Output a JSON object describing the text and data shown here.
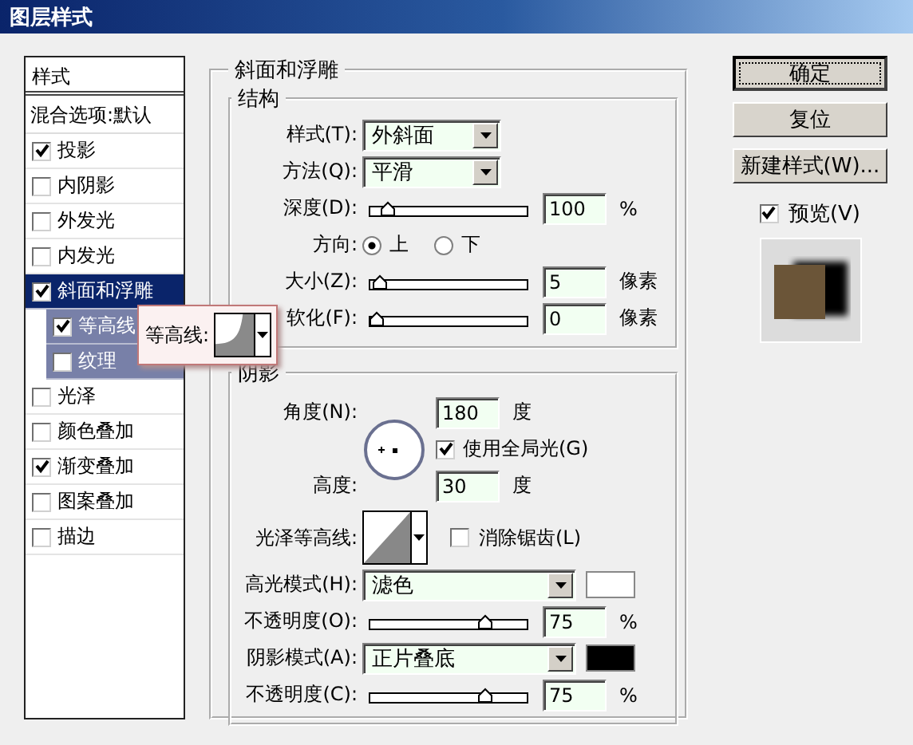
{
  "window": {
    "title": "图层样式"
  },
  "sidebar": {
    "header": "样式",
    "blend_options": "混合选项:默认",
    "items": [
      {
        "label": "投影",
        "checked": true,
        "selected": false
      },
      {
        "label": "内阴影",
        "checked": false,
        "selected": false
      },
      {
        "label": "外发光",
        "checked": false,
        "selected": false
      },
      {
        "label": "内发光",
        "checked": false,
        "selected": false
      },
      {
        "label": "斜面和浮雕",
        "checked": true,
        "selected": true,
        "children": [
          {
            "label": "等高线",
            "checked": true,
            "selected": false
          },
          {
            "label": "纹理",
            "checked": false,
            "selected": false
          }
        ]
      },
      {
        "label": "光泽",
        "checked": false,
        "selected": false
      },
      {
        "label": "颜色叠加",
        "checked": false,
        "selected": false
      },
      {
        "label": "渐变叠加",
        "checked": true,
        "selected": false
      },
      {
        "label": "图案叠加",
        "checked": false,
        "selected": false
      },
      {
        "label": "描边",
        "checked": false,
        "selected": false
      }
    ]
  },
  "contour_popup": {
    "label": "等高线:"
  },
  "bevel": {
    "title": "斜面和浮雕",
    "structure": {
      "title": "结构",
      "rows": [
        {
          "kind": "select",
          "label": "样式(T):",
          "value": "外斜面"
        },
        {
          "kind": "select",
          "label": "方法(Q):",
          "value": "平滑"
        },
        {
          "kind": "slider",
          "label": "深度(D):",
          "level": 0.08,
          "value": "100",
          "unit": "%"
        },
        {
          "kind": "radio",
          "label": "方向:",
          "options": [
            {
              "label": "上",
              "selected": true
            },
            {
              "label": "下",
              "selected": false
            }
          ]
        },
        {
          "kind": "slider",
          "label": "大小(Z):",
          "level": 0.02,
          "value": "5",
          "unit": "像素"
        },
        {
          "kind": "slider",
          "label": "软化(F):",
          "level": 0,
          "value": "0",
          "unit": "像素"
        }
      ]
    },
    "shading": {
      "title": "阴影",
      "angle": {
        "label": "角度(N):",
        "value": "180",
        "unit": "度"
      },
      "global_light": {
        "label": "使用全局光(G)",
        "checked": true
      },
      "altitude": {
        "label": "高度:",
        "value": "30",
        "unit": "度"
      },
      "gloss_contour": {
        "label": "光泽等高线:"
      },
      "anti_alias": {
        "label": "消除锯齿(L)",
        "checked": false
      },
      "rows": [
        {
          "kind": "mode",
          "label": "高光模式(H):",
          "value": "滤色",
          "color": "#ffffff"
        },
        {
          "kind": "slider",
          "label": "不透明度(O):",
          "level": 0.75,
          "value": "75",
          "unit": "%"
        },
        {
          "kind": "mode",
          "label": "阴影模式(A):",
          "value": "正片叠底",
          "color": "#000000"
        },
        {
          "kind": "slider",
          "label": "不透明度(C):",
          "level": 0.75,
          "value": "75",
          "unit": "%"
        }
      ]
    }
  },
  "buttons": [
    {
      "label": "确定",
      "default": true
    },
    {
      "label": "复位",
      "default": false
    },
    {
      "label": "新建样式(W)...",
      "default": false
    }
  ],
  "preview": {
    "label": "预览(V)",
    "checked": true
  }
}
